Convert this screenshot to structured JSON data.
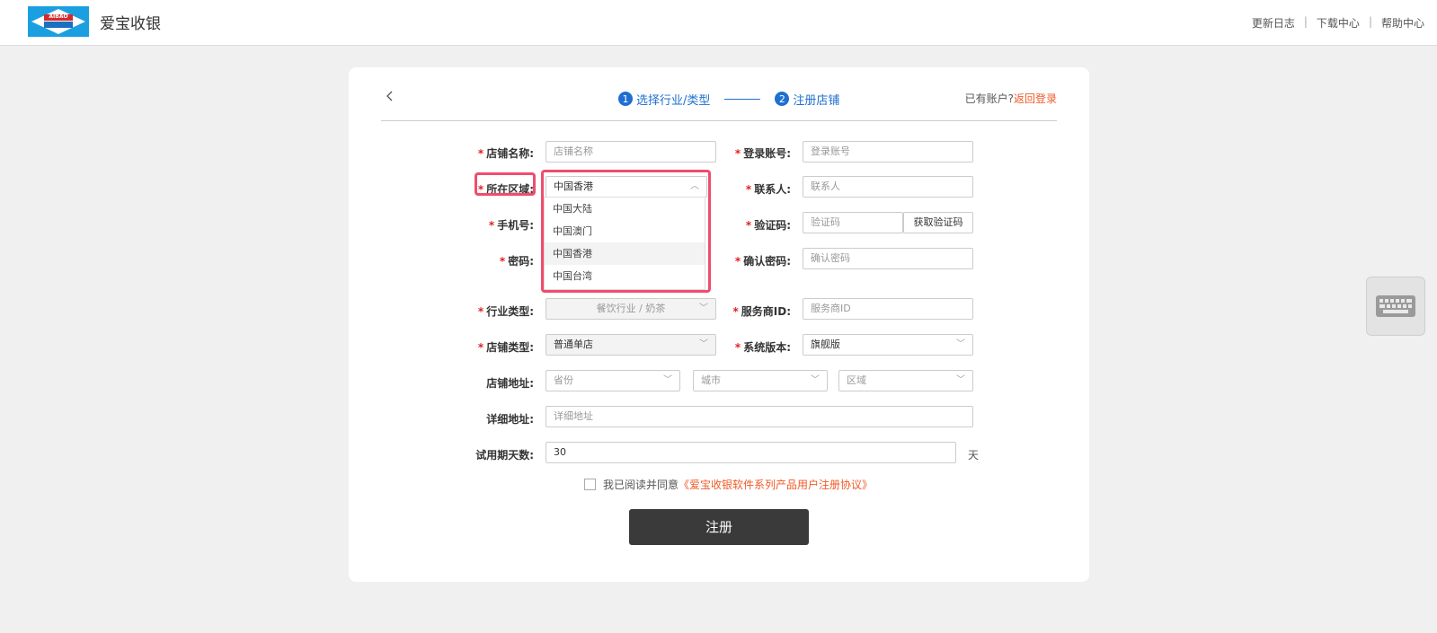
{
  "header": {
    "brand": "爱宝收银",
    "logo_text": "AIBAO",
    "links": [
      "更新日志",
      "下载中心",
      "帮助中心"
    ]
  },
  "steps": [
    {
      "num": "1",
      "label": "选择行业/类型"
    },
    {
      "num": "2",
      "label": "注册店铺"
    }
  ],
  "account": {
    "prefix": "已有账户?",
    "link": "返回登录"
  },
  "form": {
    "shop_name": {
      "label": "店铺名称:",
      "placeholder": "店铺名称"
    },
    "login_account": {
      "label": "登录账号:",
      "placeholder": "登录账号"
    },
    "region": {
      "label": "所在区域:",
      "value": "中国香港",
      "options": [
        "中国大陆",
        "中国澳门",
        "中国香港",
        "中国台湾"
      ]
    },
    "contact": {
      "label": "联系人:",
      "placeholder": "联系人"
    },
    "phone": {
      "label": "手机号:"
    },
    "verify_code": {
      "label": "验证码:",
      "placeholder": "验证码",
      "button": "获取验证码"
    },
    "password": {
      "label": "密码:"
    },
    "confirm_password": {
      "label": "确认密码:",
      "placeholder": "确认密码"
    },
    "industry": {
      "label": "行业类型:",
      "value": "餐饮行业 / 奶茶"
    },
    "provider_id": {
      "label": "服务商ID:",
      "placeholder": "服务商ID"
    },
    "shop_type": {
      "label": "店铺类型:",
      "value": "普通单店"
    },
    "system_version": {
      "label": "系统版本:",
      "value": "旗舰版"
    },
    "address": {
      "label": "店铺地址:",
      "province": "省份",
      "city": "城市",
      "district": "区域"
    },
    "detail_address": {
      "label": "详细地址:",
      "placeholder": "详细地址"
    },
    "trial_days": {
      "label": "试用期天数:",
      "value": "30",
      "unit": "天"
    }
  },
  "agreement": {
    "text": "我已阅读并同意",
    "link": "《爱宝收银软件系列产品用户注册协议》"
  },
  "register_label": "注册",
  "colors": {
    "accent": "#1e6fd0",
    "link": "#f05a28",
    "highlight": "#ef4d6e",
    "button": "#3a3a3a"
  }
}
